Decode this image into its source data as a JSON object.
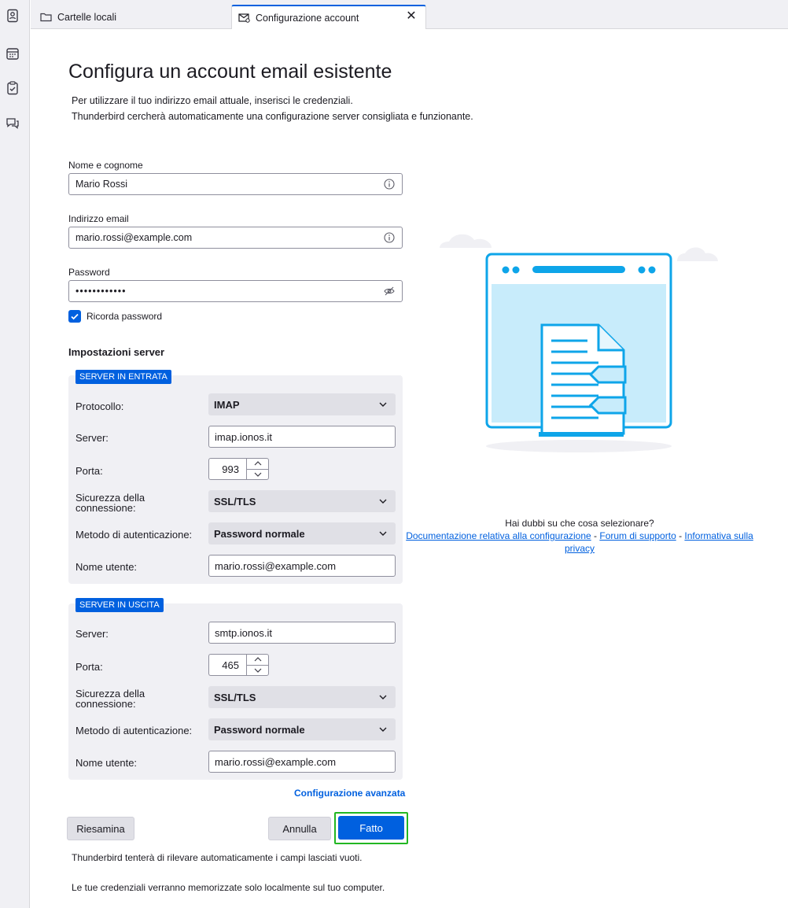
{
  "tabs": [
    {
      "label": "Cartelle locali",
      "icon": "folder-icon"
    },
    {
      "label": "Configurazione account",
      "icon": "mail-settings-icon"
    }
  ],
  "page": {
    "title": "Configura un account email esistente",
    "intro_line1": "Per utilizzare il tuo indirizzo email attuale, inserisci le credenziali.",
    "intro_line2": "Thunderbird cercherà automaticamente una configurazione server consigliata e funzionante."
  },
  "form": {
    "name_label": "Nome e cognome",
    "name_value": "Mario Rossi",
    "email_label": "Indirizzo email",
    "email_value": "mario.rossi@example.com",
    "password_label": "Password",
    "password_value": "••••••••••••",
    "remember_label": "Ricorda password",
    "remember_checked": true
  },
  "server": {
    "section_title": "Impostazioni server",
    "incoming": {
      "badge": "SERVER IN ENTRATA",
      "protocol_label": "Protocollo:",
      "protocol_value": "IMAP",
      "server_label": "Server:",
      "server_value": "imap.ionos.it",
      "port_label": "Porta:",
      "port_value": "993",
      "security_label_1": "Sicurezza della",
      "security_label_2": "connessione:",
      "security_value": "SSL/TLS",
      "auth_label": "Metodo di autenticazione:",
      "auth_value": "Password normale",
      "user_label": "Nome utente:",
      "user_value": "mario.rossi@example.com"
    },
    "outgoing": {
      "badge": "SERVER IN USCITA",
      "server_label": "Server:",
      "server_value": "smtp.ionos.it",
      "port_label": "Porta:",
      "port_value": "465",
      "security_label_1": "Sicurezza della",
      "security_label_2": "connessione:",
      "security_value": "SSL/TLS",
      "auth_label": "Metodo di autenticazione:",
      "auth_value": "Password normale",
      "user_label": "Nome utente:",
      "user_value": "mario.rossi@example.com"
    },
    "advanced_link": "Configurazione avanzata"
  },
  "buttons": {
    "retest": "Riesamina",
    "cancel": "Annulla",
    "done": "Fatto"
  },
  "notes": {
    "autodetect": "Thunderbird tenterà di rilevare automaticamente i campi lasciati vuoti.",
    "local_storage": "Le tue credenziali verranno memorizzate solo localmente sul tuo computer."
  },
  "help": {
    "question": "Hai dubbi su che cosa selezionare?",
    "link_docs": "Documentazione relativa alla configurazione",
    "sep": " - ",
    "link_forum": "Forum di supporto",
    "link_privacy": "Informativa sulla privacy"
  },
  "colors": {
    "accent": "#0060df",
    "focus_ring": "#22b722",
    "illustration": "#0ea5e9"
  }
}
